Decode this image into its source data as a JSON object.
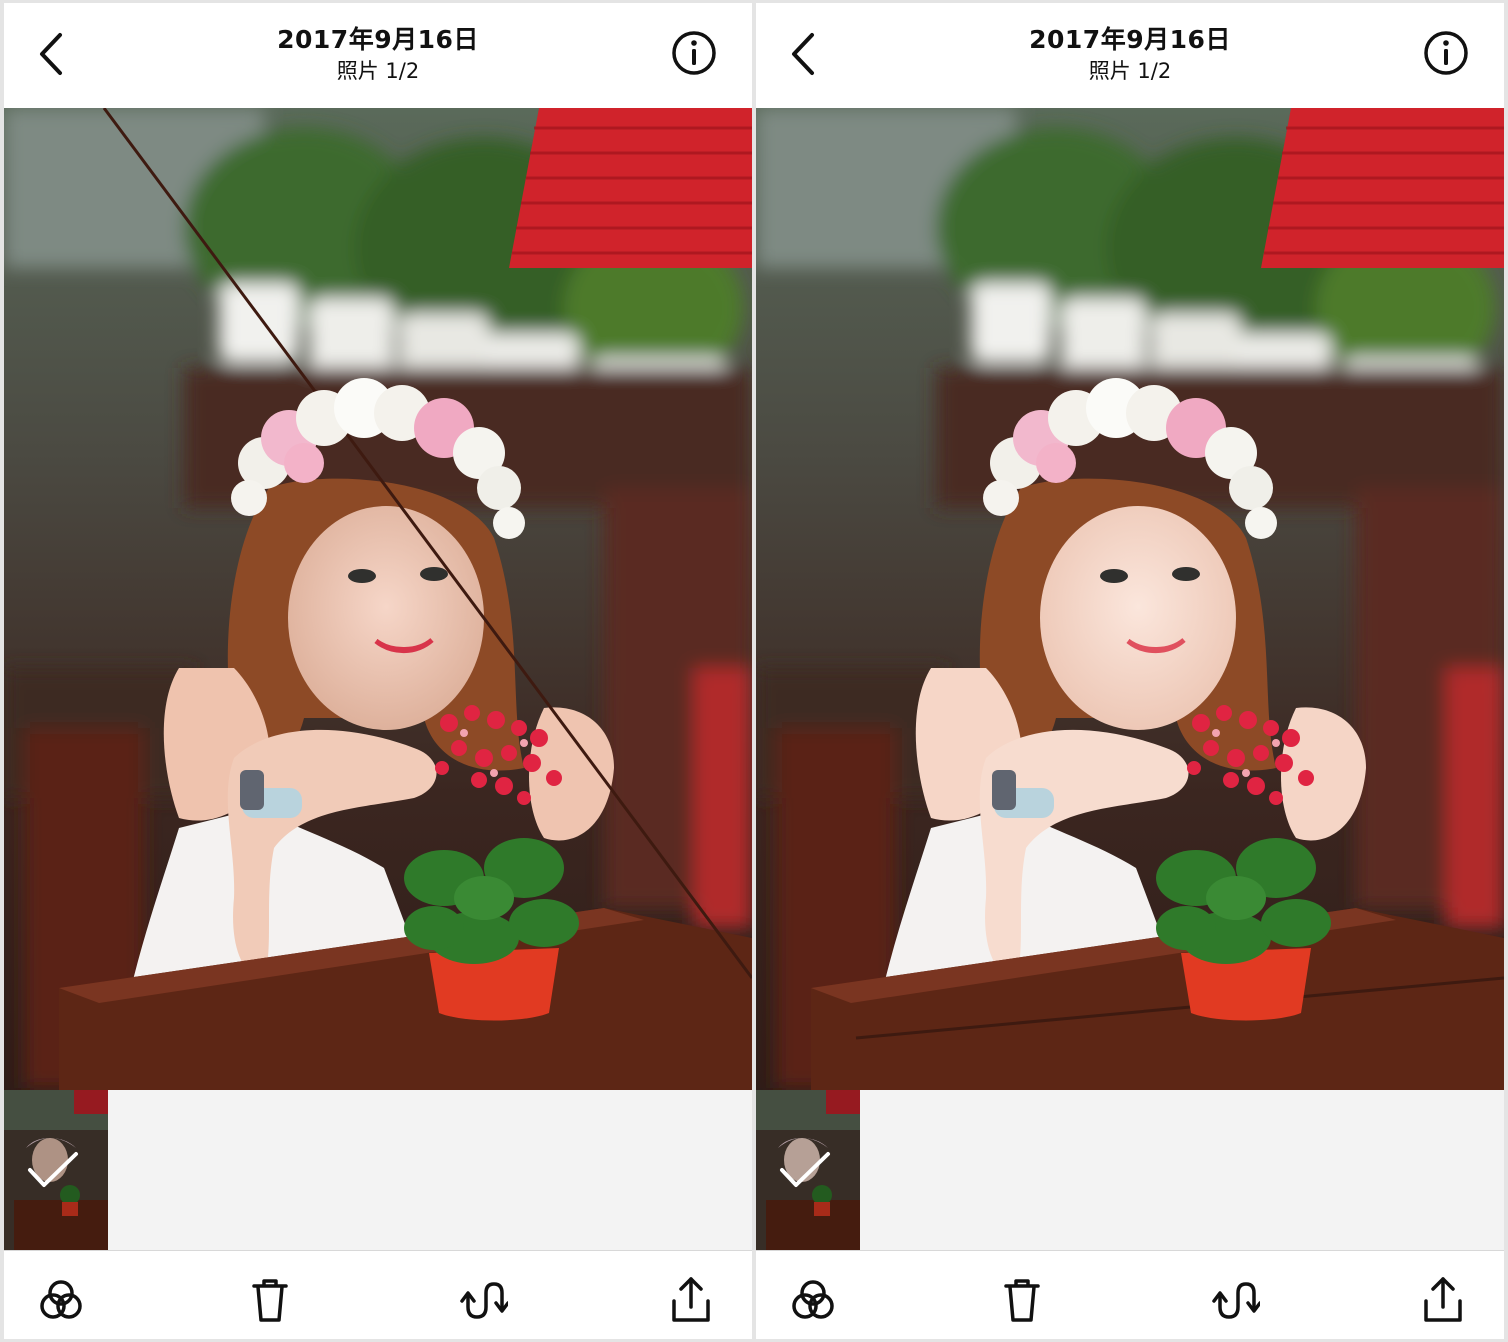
{
  "screens": [
    {
      "id": "original",
      "header": {
        "date": "2017年9月16日",
        "subtitle": "照片 1/2"
      },
      "icons": {
        "back": "chevron-left-icon",
        "info": "info-circle-icon"
      },
      "thumbnail": {
        "selected": true,
        "icon": "checkmark-icon"
      },
      "toolbar": [
        "filters-icon",
        "trash-icon",
        "swap-icon",
        "share-icon"
      ]
    },
    {
      "id": "edited",
      "header": {
        "date": "2017年9月16日",
        "subtitle": "照片 1/2"
      },
      "icons": {
        "back": "chevron-left-icon",
        "info": "info-circle-icon"
      },
      "thumbnail": {
        "selected": true,
        "icon": "checkmark-icon"
      },
      "toolbar": [
        "filters-icon",
        "trash-icon",
        "swap-icon",
        "share-icon"
      ]
    }
  ],
  "colors": {
    "accent": "#000000",
    "strip_bg": "#f3f3f3",
    "divider": "#d8d8d8"
  }
}
